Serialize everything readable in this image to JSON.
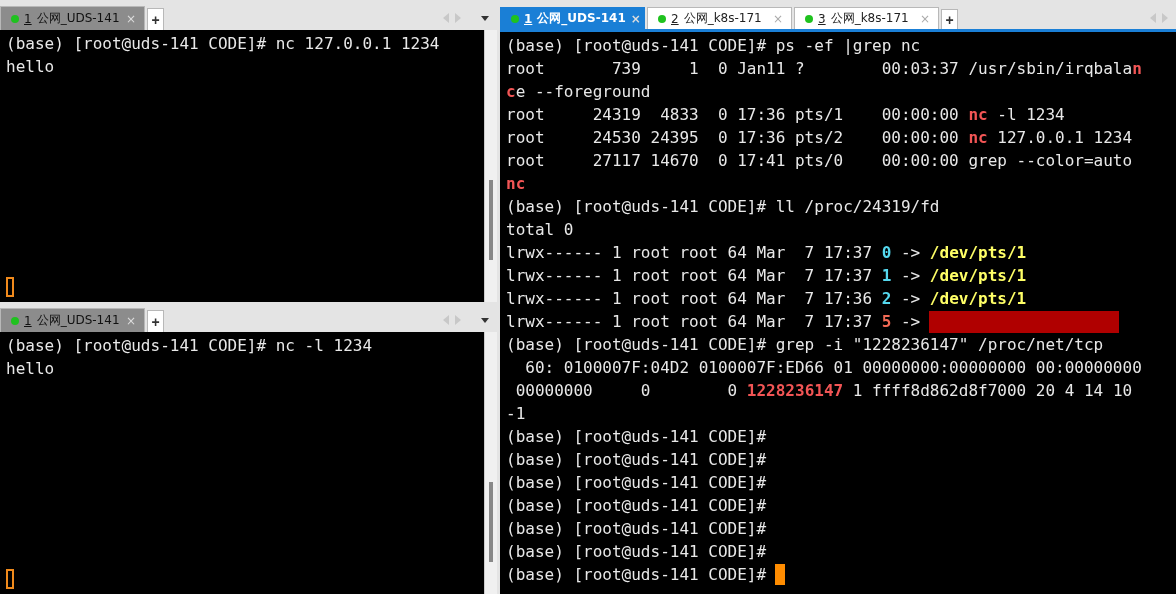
{
  "panes": [
    {
      "focused": false,
      "tabs": [
        {
          "number": "1",
          "label": "公网_UDS-141",
          "close": "×",
          "selected": true,
          "connected": true
        }
      ],
      "new_tab": "+",
      "scrollbar": true,
      "cursor": {
        "focused": false
      },
      "lines": [
        {
          "text": "(base) [root@uds-141 CODE]# nc 127.0.0.1 1234"
        },
        {
          "text": "hello"
        }
      ]
    },
    {
      "focused": false,
      "tabs": [
        {
          "number": "1",
          "label": "公网_UDS-141",
          "close": "×",
          "selected": true,
          "connected": true
        }
      ],
      "new_tab": "+",
      "scrollbar": true,
      "cursor": {
        "focused": false
      },
      "lines": [
        {
          "text": "(base) [root@uds-141 CODE]# nc -l 1234"
        },
        {
          "text": "hello"
        }
      ]
    },
    {
      "focused": true,
      "tabs": [
        {
          "number": "1",
          "label": "公网_UDS-141",
          "close": "×",
          "selected": true,
          "connected": true
        },
        {
          "number": "2",
          "label": "公网_k8s-171",
          "close": "×",
          "selected": false,
          "connected": true
        },
        {
          "number": "3",
          "label": "公网_k8s-171",
          "close": "×",
          "selected": false,
          "connected": true
        }
      ],
      "new_tab": "+",
      "cursor": {
        "focused": true
      },
      "lines": [
        {
          "text": "(base) [root@uds-141 CODE]# ps -ef |grep nc"
        },
        {
          "segments": [
            {
              "kind": "plain",
              "text": "root       739     1  0 Jan11 ?        00:03:37 /usr/sbin/irqbala"
            },
            {
              "kind": "match",
              "text": "n"
            }
          ]
        },
        {
          "segments": [
            {
              "kind": "match",
              "text": "c"
            },
            {
              "kind": "plain",
              "text": "e --foreground"
            }
          ]
        },
        {
          "segments": [
            {
              "kind": "plain",
              "text": "root     24319  4833  0 17:36 pts/1    00:00:00 "
            },
            {
              "kind": "match",
              "text": "nc"
            },
            {
              "kind": "plain",
              "text": " -l 1234"
            }
          ]
        },
        {
          "segments": [
            {
              "kind": "plain",
              "text": "root     24530 24395  0 17:36 pts/2    00:00:00 "
            },
            {
              "kind": "match",
              "text": "nc"
            },
            {
              "kind": "plain",
              "text": " 127.0.0.1 1234"
            }
          ]
        },
        {
          "text": "root     27117 14670  0 17:41 pts/0    00:00:00 grep --color=auto"
        },
        {
          "segments": [
            {
              "kind": "match",
              "text": "nc"
            }
          ]
        },
        {
          "text": "(base) [root@uds-141 CODE]# ll /proc/24319/fd"
        },
        {
          "text": "total 0"
        },
        {
          "segments": [
            {
              "kind": "plain",
              "text": "lrwx------ 1 root root 64 Mar  7 17:37 "
            },
            {
              "kind": "fd",
              "text": "0"
            },
            {
              "kind": "plain",
              "text": " -> "
            },
            {
              "kind": "device",
              "text": "/dev/pts/1"
            }
          ]
        },
        {
          "segments": [
            {
              "kind": "plain",
              "text": "lrwx------ 1 root root 64 Mar  7 17:37 "
            },
            {
              "kind": "fd",
              "text": "1"
            },
            {
              "kind": "plain",
              "text": " -> "
            },
            {
              "kind": "device",
              "text": "/dev/pts/1"
            }
          ]
        },
        {
          "segments": [
            {
              "kind": "plain",
              "text": "lrwx------ 1 root root 64 Mar  7 17:36 "
            },
            {
              "kind": "fd",
              "text": "2"
            },
            {
              "kind": "plain",
              "text": " -> "
            },
            {
              "kind": "device",
              "text": "/dev/pts/1"
            }
          ]
        },
        {
          "segments": [
            {
              "kind": "plain",
              "text": "lrwx------ 1 root root 64 Mar  7 17:37 "
            },
            {
              "kind": "socket",
              "text": "5"
            },
            {
              "kind": "plain",
              "text": " ->"
            }
          ],
          "redacted": true
        },
        {
          "text": "(base) [root@uds-141 CODE]# grep -i \"1228236147\" /proc/net/tcp"
        },
        {
          "text": "  60: 0100007F:04D2 0100007F:ED66 01 00000000:00000000 00:00000000"
        },
        {
          "segments": [
            {
              "kind": "plain",
              "text": " 00000000     0        0 "
            },
            {
              "kind": "match",
              "text": "1228236147"
            },
            {
              "kind": "plain",
              "text": " 1 ffff8d862d8f7000 20 4 14 10"
            }
          ]
        },
        {
          "text": "-1"
        },
        {
          "text": "(base) [root@uds-141 CODE]#"
        },
        {
          "text": "(base) [root@uds-141 CODE]#"
        },
        {
          "text": "(base) [root@uds-141 CODE]#"
        },
        {
          "text": "(base) [root@uds-141 CODE]#"
        },
        {
          "text": "(base) [root@uds-141 CODE]#"
        },
        {
          "text": "(base) [root@uds-141 CODE]#"
        },
        {
          "text": "(base) [root@uds-141 CODE]#"
        }
      ]
    }
  ]
}
